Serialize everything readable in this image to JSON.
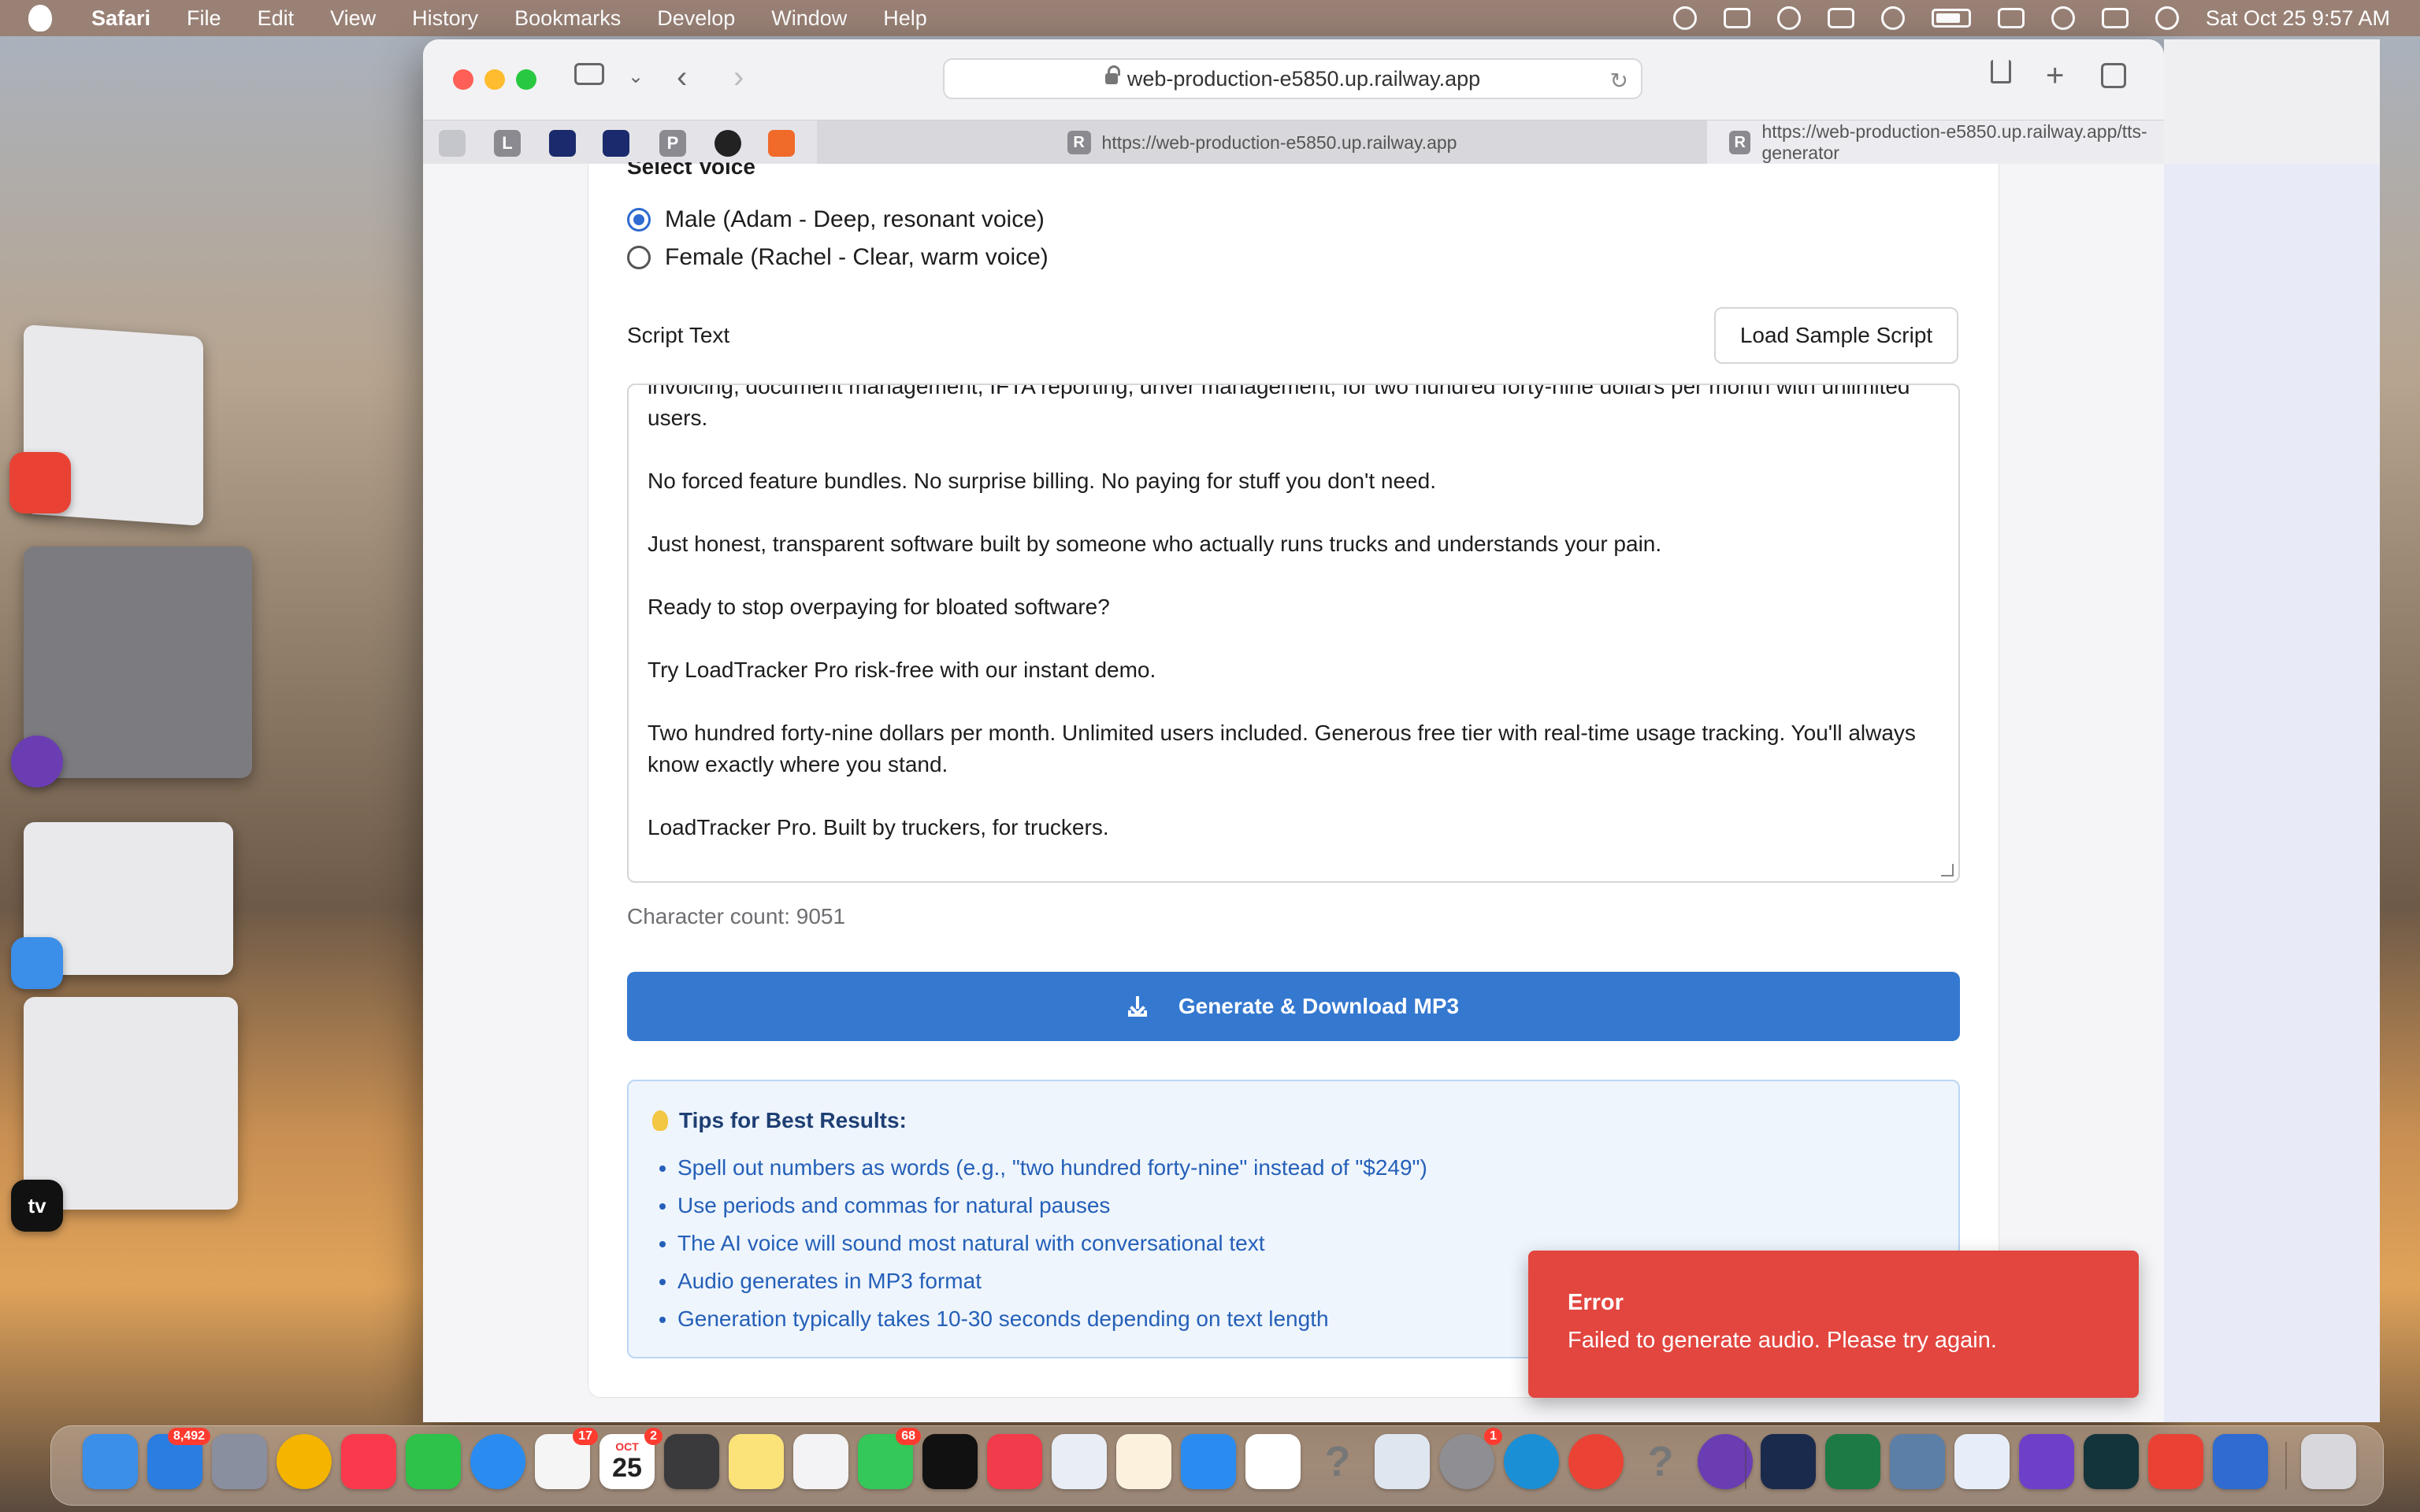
{
  "menubar": {
    "app": "Safari",
    "items": [
      "File",
      "Edit",
      "View",
      "History",
      "Bookmarks",
      "Develop",
      "Window",
      "Help"
    ],
    "datetime": "Sat Oct 25  9:57 AM"
  },
  "browser": {
    "address": "web-production-e5850.up.railway.app",
    "pinned_tabs": [
      "L",
      "P"
    ],
    "tabs": [
      {
        "favicon": "R",
        "title": "https://web-production-e5850.up.railway.app"
      },
      {
        "favicon": "R",
        "title": "https://web-production-e5850.up.railway.app/tts-generator"
      }
    ]
  },
  "form": {
    "voice_label": "Select Voice",
    "voice_options": [
      {
        "label": "Male (Adam - Deep, resonant voice)",
        "selected": true
      },
      {
        "label": "Female (Rachel - Clear, warm voice)",
        "selected": false
      }
    ],
    "script_label": "Script Text",
    "load_sample_label": "Load Sample Script",
    "script_paragraphs": [
      "invoicing, document management, IFTA reporting, driver management, for two hundred forty-nine dollars per month with unlimited users.",
      "No forced feature bundles. No surprise billing. No paying for stuff you don't need.",
      "Just honest, transparent software built by someone who actually runs trucks and understands your pain.",
      "Ready to stop overpaying for bloated software?",
      "Try LoadTracker Pro risk-free with our instant demo.",
      "Two hundred forty-nine dollars per month. Unlimited users included. Generous free tier with real-time usage tracking. You'll always know exactly where you stand.",
      "LoadTracker Pro. Built by truckers, for truckers."
    ],
    "char_count": "Character count: 9051",
    "generate_label": "Generate & Download MP3"
  },
  "tips": {
    "title": "Tips for Best Results:",
    "items": [
      "Spell out numbers as words (e.g., \"two hundred forty-nine\" instead of \"$249\")",
      "Use periods and commas for natural pauses",
      "The AI voice will sound most natural with conversational text",
      "Audio generates in MP3 format",
      "Generation typically takes 10-30 seconds depending on text length"
    ]
  },
  "toast": {
    "title": "Error",
    "message": "Failed to generate audio. Please try again."
  },
  "dock": {
    "badges": {
      "mail": "8,492",
      "reminders": "17",
      "calendar_month": "OCT",
      "calendar_day": "25",
      "messages": "68",
      "settings": "1",
      "calendar_badge": "2"
    },
    "tv_label": "tv"
  },
  "colors": {
    "primary": "#3478d0",
    "error": "#e2463f",
    "tips_bg": "#eef5fd"
  }
}
